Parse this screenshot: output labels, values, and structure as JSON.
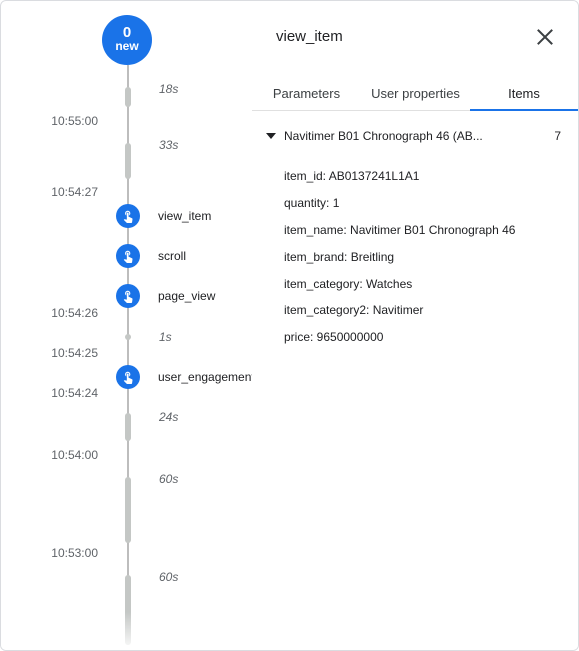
{
  "timeline": {
    "new_badge": {
      "count": "0",
      "label": "new"
    },
    "times": [
      "10:55:00",
      "10:54:27",
      "10:54:26",
      "10:54:25",
      "10:54:24",
      "10:54:00",
      "10:53:00"
    ],
    "durations": [
      "18s",
      "33s",
      "1s",
      "24s",
      "60s",
      "60s"
    ],
    "events": [
      {
        "label": "view_item",
        "icon": "touch-icon"
      },
      {
        "label": "scroll",
        "icon": "touch-icon"
      },
      {
        "label": "page_view",
        "icon": "touch-icon"
      },
      {
        "label": "user_engagement",
        "icon": "touch-icon"
      }
    ]
  },
  "panel": {
    "title": "view_item",
    "close_icon": "close-icon",
    "tabs": [
      {
        "label": "Parameters",
        "active": false
      },
      {
        "label": "User properties",
        "active": false
      },
      {
        "label": "Items",
        "active": true
      }
    ],
    "item": {
      "name": "Navitimer B01 Chronograph 46 (AB...",
      "count": "7",
      "params": [
        "item_id: AB0137241L1A1",
        "quantity: 1",
        "item_name: Navitimer B01 Chronograph 46",
        "item_brand: Breitling",
        "item_category: Watches",
        "item_category2: Navitimer",
        "price: 9650000000"
      ]
    }
  },
  "colors": {
    "accent": "#1a73e8",
    "timeline_segment": "#c4c7c5"
  }
}
